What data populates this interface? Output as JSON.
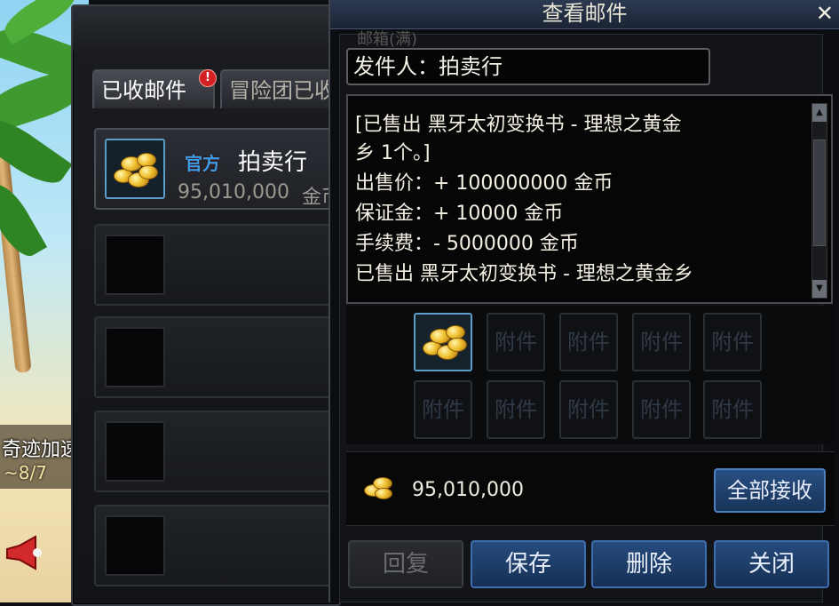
{
  "background": {
    "buff_title": "奇迹加速",
    "buff_count": "~8/7"
  },
  "mail_panel": {
    "tabs": [
      {
        "label": "已收邮件",
        "badge": "!"
      },
      {
        "label": "冒险团已收"
      }
    ],
    "rows": [
      {
        "official_label": "官方",
        "sender": "拍卖行",
        "amount": "95,010,000",
        "unit": "金币"
      }
    ]
  },
  "view_mail": {
    "title": "查看邮件",
    "close_symbol": "✕",
    "mailbox_count": "邮箱(满)",
    "sender_label": "发件人：拍卖行",
    "message_lines": [
      "[已售出 黑牙太初变换书 - 理想之黄金",
      "乡 1个。]",
      " 出售价：+ 100000000 金币",
      " 保证金：+ 10000 金币",
      " 手续费：- 5000000 金币",
      "已售出 黑牙太初变换书 - 理想之黄金乡"
    ],
    "attachment_placeholder": "附件",
    "gold_amount": "95,010,000",
    "receive_all": "全部接收",
    "buttons": {
      "reply": "回复",
      "save": "保存",
      "delete": "删除",
      "close": "关闭"
    }
  },
  "colors": {
    "button_blue": "#264b7d",
    "gold": "#f0c030",
    "highlight_border": "#5a9ec9"
  }
}
